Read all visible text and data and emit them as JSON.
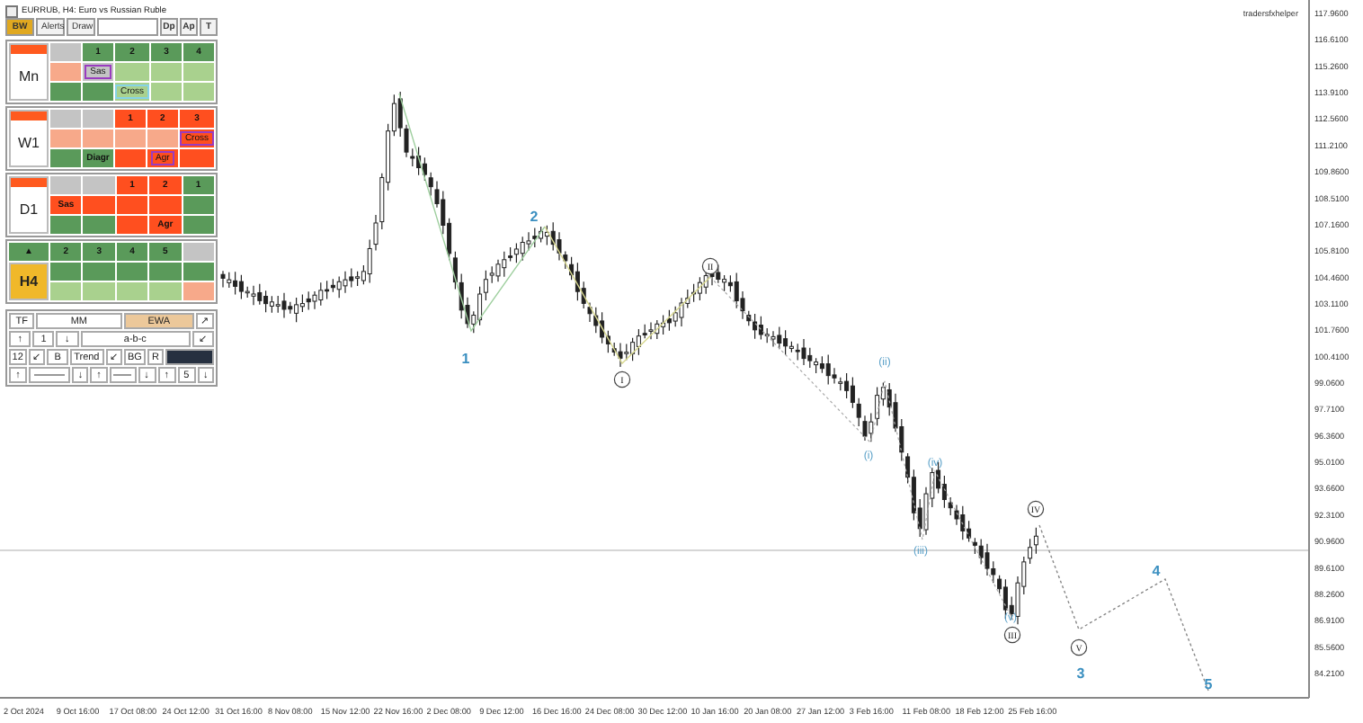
{
  "chart": {
    "title": "EURRUB, H4: Euro vs Russian Ruble",
    "brand_label": "tradersfxhelper",
    "price_labels": [
      "117.9600",
      "116.6100",
      "115.2600",
      "113.9100",
      "112.5600",
      "111.2100",
      "109.8600",
      "108.5100",
      "107.1600",
      "105.8100",
      "104.4600",
      "103.1100",
      "101.7600",
      "100.4100",
      "99.0600",
      "97.7100",
      "96.3600",
      "95.0100",
      "93.6600",
      "92.3100",
      "90.9600",
      "89.6100",
      "88.2600",
      "86.9100",
      "85.5600",
      "84.2100"
    ],
    "time_labels": [
      "2 Oct 2024",
      "9 Oct 16:00",
      "17 Oct 08:00",
      "24 Oct 12:00",
      "31 Oct 16:00",
      "8 Nov 08:00",
      "15 Nov 12:00",
      "22 Nov 16:00",
      "2 Dec 08:00",
      "9 Dec 12:00",
      "16 Dec 16:00",
      "24 Dec 08:00",
      "30 Dec 12:00",
      "10 Jan 16:00",
      "20 Jan 08:00",
      "27 Jan 12:00",
      "3 Feb 16:00",
      "11 Feb 08:00",
      "18 Feb 12:00",
      "25 Feb 16:00"
    ],
    "wave_labels": [
      {
        "text": "1",
        "kind": "number"
      },
      {
        "text": "2",
        "kind": "number"
      },
      {
        "text": "I",
        "kind": "circled"
      },
      {
        "text": "II",
        "kind": "circled"
      },
      {
        "text": "(i)",
        "kind": "minor"
      },
      {
        "text": "(ii)",
        "kind": "minor"
      },
      {
        "text": "(iii)",
        "kind": "minor"
      },
      {
        "text": "(iv)",
        "kind": "minor"
      },
      {
        "text": "(v)",
        "kind": "minor"
      },
      {
        "text": "III",
        "kind": "circled"
      },
      {
        "text": "IV",
        "kind": "circled"
      },
      {
        "text": "V",
        "kind": "circled"
      },
      {
        "text": "3",
        "kind": "number"
      },
      {
        "text": "4",
        "kind": "number"
      },
      {
        "text": "5",
        "kind": "number"
      }
    ]
  },
  "panel": {
    "toolbar_left": [
      {
        "label": "BW",
        "selected": true
      },
      {
        "label": "Alerts",
        "selected": false
      },
      {
        "label": "Draw",
        "selected": false
      }
    ],
    "toolbar_right": [
      "Dp",
      "Ap",
      "T"
    ],
    "timeframes": [
      {
        "label": "Mn",
        "strip": true,
        "highlighted": false,
        "rows": [
          [
            {
              "color": "#c4c4c4"
            },
            {
              "text": "1",
              "color": "#5a9a5a"
            },
            {
              "text": "2",
              "color": "#5a9a5a"
            },
            {
              "text": "3",
              "color": "#5a9a5a"
            },
            {
              "text": "4",
              "color": "#5a9a5a"
            }
          ],
          [
            {
              "color": "#f7a98a"
            },
            {
              "text": "Sas",
              "color": "#c4c4c4",
              "frame": {
                "color": "#9a3cc0"
              }
            },
            {
              "color": "#a9d18e"
            },
            {
              "color": "#a9d18e"
            },
            {
              "color": "#a9d18e"
            }
          ],
          [
            {
              "color": "#5a9a5a"
            },
            {
              "color": "#5a9a5a"
            },
            {
              "text": "Cross",
              "color": "#a9d18e",
              "frame": {
                "color": "#86d3e6"
              }
            },
            {
              "color": "#a9d18e"
            },
            {
              "color": "#a9d18e"
            }
          ]
        ]
      },
      {
        "label": "W1",
        "strip": true,
        "highlighted": false,
        "rows": [
          [
            {
              "color": "#c4c4c4"
            },
            {
              "color": "#c4c4c4"
            },
            {
              "text": "1",
              "color": "#ff4f1f"
            },
            {
              "text": "2",
              "color": "#ff4f1f"
            },
            {
              "text": "3",
              "color": "#ff4f1f"
            }
          ],
          [
            {
              "color": "#f7a98a"
            },
            {
              "color": "#f7a98a"
            },
            {
              "color": "#f7a98a"
            },
            {
              "color": "#f7a98a"
            },
            {
              "text": "Cross",
              "color": "#ff4f1f",
              "frame": {
                "color": "#9a3cc0"
              }
            }
          ],
          [
            {
              "color": "#5a9a5a"
            },
            {
              "text": "Diagr",
              "color": "#5a9a5a"
            },
            {
              "color": "#ff4f1f"
            },
            {
              "text": "Agr",
              "color": "#ff4f1f",
              "frame": {
                "color": "#9a3cc0"
              }
            },
            {
              "color": "#ff4f1f"
            }
          ]
        ]
      },
      {
        "label": "D1",
        "strip": true,
        "highlighted": false,
        "rows": [
          [
            {
              "color": "#c4c4c4"
            },
            {
              "color": "#c4c4c4"
            },
            {
              "text": "1",
              "color": "#ff4f1f"
            },
            {
              "text": "2",
              "color": "#ff4f1f"
            },
            {
              "text": "1",
              "color": "#5a9a5a"
            }
          ],
          [
            {
              "text": "Sas",
              "color": "#ff4f1f"
            },
            {
              "color": "#ff4f1f"
            },
            {
              "color": "#ff4f1f"
            },
            {
              "color": "#ff4f1f"
            },
            {
              "color": "#5a9a5a"
            }
          ],
          [
            {
              "color": "#5a9a5a"
            },
            {
              "color": "#5a9a5a"
            },
            {
              "color": "#ff4f1f"
            },
            {
              "text": "Agr",
              "color": "#ff4f1f"
            },
            {
              "color": "#5a9a5a"
            }
          ]
        ]
      },
      {
        "label": "H4",
        "strip": false,
        "highlighted": true,
        "marker": "▲",
        "rows": [
          [
            {
              "text": "2",
              "color": "#5a9a5a"
            },
            {
              "text": "3",
              "color": "#5a9a5a"
            },
            {
              "text": "4",
              "color": "#5a9a5a"
            },
            {
              "text": "5",
              "color": "#5a9a5a"
            },
            {
              "color": "#c4c4c4"
            }
          ],
          [
            {
              "color": "#5a9a5a"
            },
            {
              "color": "#5a9a5a"
            },
            {
              "color": "#5a9a5a"
            },
            {
              "color": "#5a9a5a"
            },
            {
              "color": "#5a9a5a"
            }
          ],
          [
            {
              "color": "#a9d18e"
            },
            {
              "color": "#a9d18e"
            },
            {
              "color": "#a9d18e"
            },
            {
              "color": "#a9d18e"
            },
            {
              "color": "#f7a98a"
            }
          ]
        ]
      }
    ],
    "controls": [
      [
        {
          "kind": "button",
          "text": "TF"
        },
        {
          "kind": "button",
          "text": "MM"
        },
        {
          "kind": "accent",
          "text": "EWA"
        },
        {
          "kind": "button",
          "text": "↗"
        }
      ],
      [
        {
          "kind": "button",
          "text": "↑"
        },
        {
          "kind": "button",
          "text": "1"
        },
        {
          "kind": "button",
          "text": "↓"
        },
        {
          "kind": "button",
          "text": "a-b-c"
        },
        {
          "kind": "button",
          "text": "↙"
        }
      ],
      [
        {
          "kind": "button",
          "text": "12"
        },
        {
          "kind": "button",
          "text": "↙"
        },
        {
          "kind": "button",
          "text": "B"
        },
        {
          "kind": "button",
          "text": "Trend"
        },
        {
          "kind": "button",
          "text": "↙"
        },
        {
          "kind": "button",
          "text": "BG"
        },
        {
          "kind": "button",
          "text": "R"
        },
        {
          "kind": "dark"
        }
      ],
      [
        {
          "kind": "button",
          "text": "↑"
        },
        {
          "kind": "line"
        },
        {
          "kind": "button",
          "text": "↓"
        },
        {
          "kind": "button",
          "text": "↑"
        },
        {
          "kind": "line"
        },
        {
          "kind": "button",
          "text": "↓"
        },
        {
          "kind": "button",
          "text": "↑"
        },
        {
          "kind": "button",
          "text": "5"
        },
        {
          "kind": "button",
          "text": "↓"
        }
      ]
    ]
  }
}
